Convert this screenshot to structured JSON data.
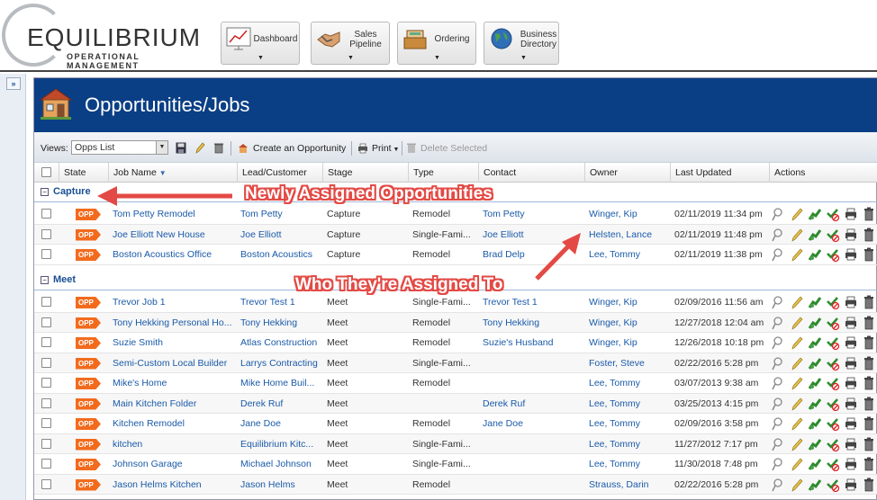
{
  "brand": {
    "name": "EQUILIBRIUM",
    "tagline": "OPERATIONAL MANAGEMENT"
  },
  "nav": [
    {
      "label": "Dashboard",
      "icon": "dashboard-chart-icon"
    },
    {
      "label": "Sales Pipeline",
      "icon": "handshake-icon"
    },
    {
      "label": "Ordering",
      "icon": "cash-register-icon"
    },
    {
      "label": "Business Directory",
      "icon": "globe-icon"
    }
  ],
  "sidebar": {
    "expand_label": "»"
  },
  "page": {
    "title": "Opportunities/Jobs"
  },
  "toolbar": {
    "views_label": "Views:",
    "view_value": "Opps List",
    "create_label": "Create an Opportunity",
    "print_label": "Print",
    "delete_label": "Delete Selected"
  },
  "columns": [
    "State",
    "Job Name",
    "Lead/Customer",
    "Stage",
    "Type",
    "Contact",
    "Owner",
    "Last Updated",
    "Actions"
  ],
  "badge": "OPP",
  "groups": [
    {
      "label": "Capture",
      "rows": [
        {
          "job": "Tom Petty Remodel",
          "lead": "Tom Petty",
          "stage": "Capture",
          "type": "Remodel",
          "contact": "Tom Petty",
          "owner": "Winger, Kip",
          "updated": "02/11/2019 11:34 pm"
        },
        {
          "job": "Joe Elliott New House",
          "lead": "Joe Elliott",
          "stage": "Capture",
          "type": "Single-Fami...",
          "contact": "Joe Elliott",
          "owner": "Helsten, Lance",
          "updated": "02/11/2019 11:48 pm"
        },
        {
          "job": "Boston Acoustics Office",
          "lead": "Boston Acoustics",
          "stage": "Capture",
          "type": "Remodel",
          "contact": "Brad Delp",
          "owner": "Lee, Tommy",
          "updated": "02/11/2019 11:38 pm"
        }
      ]
    },
    {
      "label": "Meet",
      "rows": [
        {
          "job": "Trevor Job 1",
          "lead": "Trevor Test 1",
          "stage": "Meet",
          "type": "Single-Fami...",
          "contact": "Trevor Test 1",
          "owner": "Winger, Kip",
          "updated": "02/09/2016 11:56 am"
        },
        {
          "job": "Tony Hekking Personal Ho...",
          "lead": "Tony Hekking",
          "stage": "Meet",
          "type": "Remodel",
          "contact": "Tony Hekking",
          "owner": "Winger, Kip",
          "updated": "12/27/2018 12:04 am"
        },
        {
          "job": "Suzie Smith",
          "lead": "Atlas Construction",
          "stage": "Meet",
          "type": "Remodel",
          "contact": "Suzie's Husband",
          "owner": "Winger, Kip",
          "updated": "12/26/2018 10:18 pm"
        },
        {
          "job": "Semi-Custom Local Builder",
          "lead": "Larrys Contracting",
          "stage": "Meet",
          "type": "Single-Fami...",
          "contact": "",
          "owner": "Foster, Steve",
          "updated": "02/22/2016 5:28 pm"
        },
        {
          "job": "Mike's Home",
          "lead": "Mike Home Buil...",
          "stage": "Meet",
          "type": "Remodel",
          "contact": "",
          "owner": "Lee, Tommy",
          "updated": "03/07/2013 9:38 am"
        },
        {
          "job": "Main Kitchen Folder",
          "lead": "Derek Ruf",
          "stage": "Meet",
          "type": "",
          "contact": "Derek Ruf",
          "owner": "Lee, Tommy",
          "updated": "03/25/2013 4:15 pm"
        },
        {
          "job": "Kitchen Remodel",
          "lead": "Jane Doe",
          "stage": "Meet",
          "type": "Remodel",
          "contact": "Jane Doe",
          "owner": "Lee, Tommy",
          "updated": "02/09/2016 3:58 pm"
        },
        {
          "job": "kitchen",
          "lead": "Equilibrium Kitc...",
          "stage": "Meet",
          "type": "Single-Fami...",
          "contact": "",
          "owner": "Lee, Tommy",
          "updated": "11/27/2012 7:17 pm"
        },
        {
          "job": "Johnson Garage",
          "lead": "Michael Johnson",
          "stage": "Meet",
          "type": "Single-Fami...",
          "contact": "",
          "owner": "Lee, Tommy",
          "updated": "11/30/2018 7:48 pm"
        },
        {
          "job": "Jason Helms Kitchen",
          "lead": "Jason Helms",
          "stage": "Meet",
          "type": "Remodel",
          "contact": "",
          "owner": "Strauss, Darin",
          "updated": "02/22/2016 5:28 pm"
        }
      ]
    }
  ],
  "annotations": {
    "callout_1": "Newly Assigned Opportunities",
    "callout_2": "Who They're Assigned To",
    "color": "#e34a45"
  },
  "colors": {
    "header_blue": "#0b3f85",
    "link": "#1a5aa8",
    "badge": "#f26b1d"
  }
}
